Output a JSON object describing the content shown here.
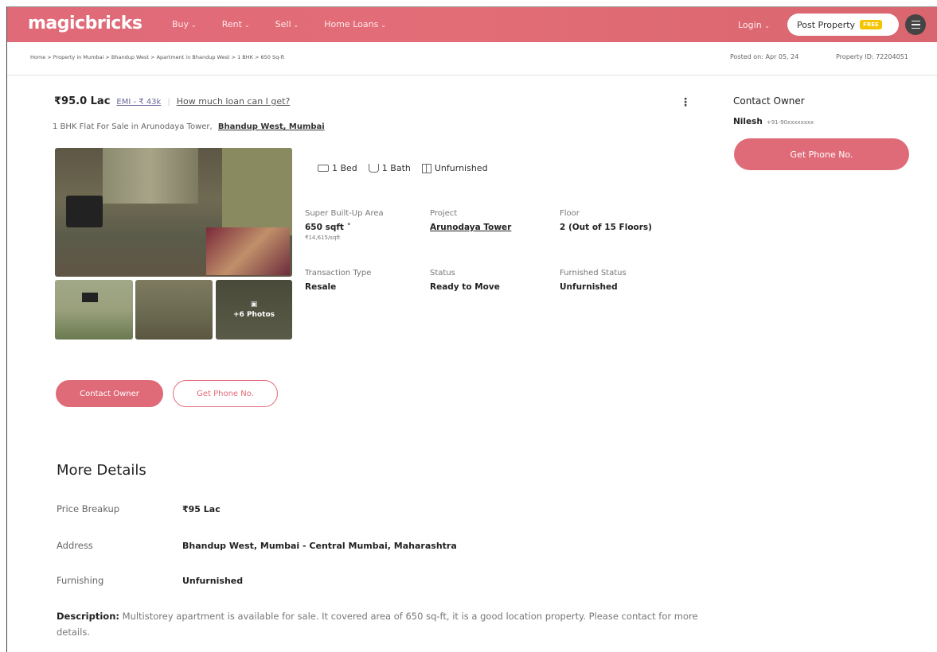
{
  "header": {
    "logo": "magicbricks",
    "nav": [
      {
        "label": "Buy"
      },
      {
        "label": "Rent"
      },
      {
        "label": "Sell"
      },
      {
        "label": "Home Loans"
      }
    ],
    "login": "Login",
    "post_property": "Post Property",
    "free_badge": "FREE",
    "brand_color": "#e06b78"
  },
  "breadcrumb": {
    "path": "Home > Property in Mumbai > Bhandup West > Apartment in Bhandup West > 1 BHK > 650 Sq-ft",
    "posted_on": "Posted on: Apr 05, 24",
    "property_id": "Property ID: 72204051"
  },
  "summary": {
    "price": "₹95.0 Lac",
    "emi": "EMI - ₹ 43k",
    "separator": "|",
    "loan_link": "How much loan can I get?",
    "title": "1 BHK Flat For Sale in Arunodaya Tower,",
    "location": "Bhandup West, Mumbai",
    "more_photos": "+6 Photos"
  },
  "features": {
    "bed": "1 Bed",
    "bath": "1 Bath",
    "furnishing": "Unfurnished"
  },
  "details": {
    "area_label": "Super Built-Up Area",
    "area_value": "650 sqft ˅",
    "area_rate": "₹14,615/sqft",
    "project_label": "Project",
    "project_value": "Arunodaya Tower",
    "floor_label": "Floor",
    "floor_value": "2 (Out of 15 Floors)",
    "transaction_label": "Transaction Type",
    "transaction_value": "Resale",
    "status_label": "Status",
    "status_value": "Ready to Move",
    "furnished_label": "Furnished Status",
    "furnished_value": "Unfurnished"
  },
  "actions": {
    "contact_owner": "Contact Owner",
    "get_phone": "Get Phone No."
  },
  "sidebar": {
    "title": "Contact Owner",
    "owner_name": "Nilesh",
    "owner_phone": "+91-90xxxxxxxx",
    "get_phone": "Get Phone No."
  },
  "more_details": {
    "title": "More Details",
    "rows": [
      {
        "key": "Price Breakup",
        "value": "₹95 Lac"
      },
      {
        "key": "Address",
        "value": "Bhandup West, Mumbai - Central Mumbai, Maharashtra"
      },
      {
        "key": "Furnishing",
        "value": "Unfurnished"
      }
    ],
    "description_label": "Description:",
    "description": "Multistorey apartment is available for sale. It covered area of 650 sq-ft, it is a good location property. Please contact for more details."
  }
}
